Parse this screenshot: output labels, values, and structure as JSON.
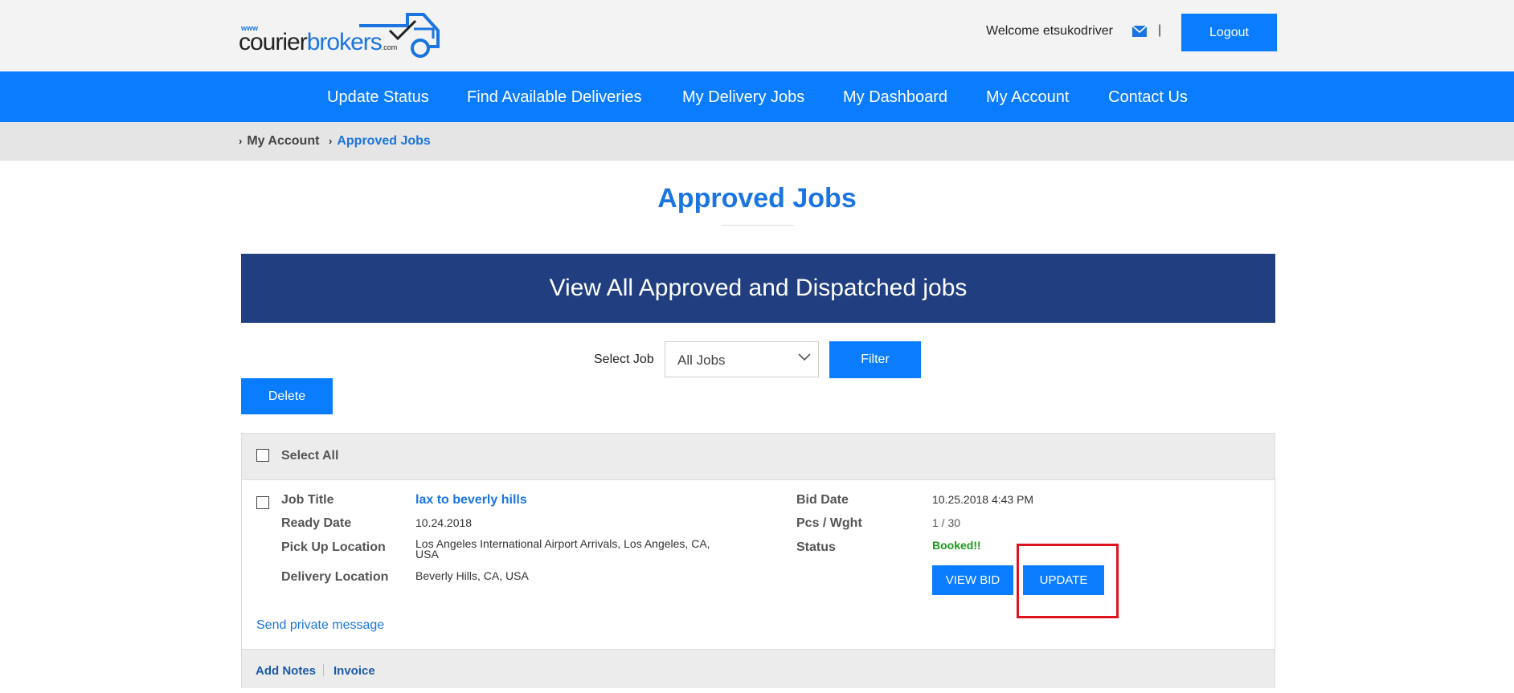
{
  "header": {
    "logo": {
      "www": "www",
      "courier": "courier",
      "brokers": "brokers",
      "com": ".com"
    },
    "welcome": "Welcome etsukodriver",
    "separator": "|",
    "logout_label": "Logout"
  },
  "nav": {
    "items": [
      {
        "label": "Update Status"
      },
      {
        "label": "Find Available Deliveries"
      },
      {
        "label": "My Delivery Jobs"
      },
      {
        "label": "My Dashboard"
      },
      {
        "label": "My Account"
      },
      {
        "label": "Contact Us"
      }
    ]
  },
  "breadcrumb": {
    "items": [
      {
        "label": "My Account"
      },
      {
        "label": "Approved Jobs"
      }
    ]
  },
  "page": {
    "title": "Approved Jobs",
    "banner": "View All Approved and Dispatched jobs"
  },
  "filter": {
    "label": "Select Job",
    "selected": "All Jobs",
    "filter_label": "Filter",
    "delete_label": "Delete"
  },
  "jobs": {
    "select_all_label": "Select All",
    "rows": [
      {
        "job_title_label": "Job Title",
        "job_title": "lax to beverly hills",
        "ready_date_label": "Ready Date",
        "ready_date": "10.24.2018",
        "pickup_label": "Pick Up Location",
        "pickup": "Los Angeles International Airport Arrivals, Los Angeles, CA, USA",
        "delivery_label": "Delivery Location",
        "delivery": "Beverly Hills, CA, USA",
        "bid_date_label": "Bid Date",
        "bid_date": "10.25.2018 4:43 PM",
        "pcs_label": "Pcs / Wght",
        "pcs": "1 / 30",
        "status_label": "Status",
        "status": "Booked!!",
        "view_bid_label": "VIEW BID",
        "update_label": "UPDATE",
        "private_message_label": "Send private message",
        "add_notes_label": "Add Notes",
        "invoice_label": "Invoice"
      }
    ]
  },
  "colors": {
    "primary": "#0a7cff",
    "banner": "#213f80",
    "title": "#1b75e0",
    "status_ok": "#1a9a1a",
    "highlight": "#e0141e"
  },
  "icons": {
    "mail": "mail-icon",
    "chevron": "chevron-right-icon",
    "dropdown": "chevron-down-icon",
    "logo_truck": "truck-icon"
  }
}
